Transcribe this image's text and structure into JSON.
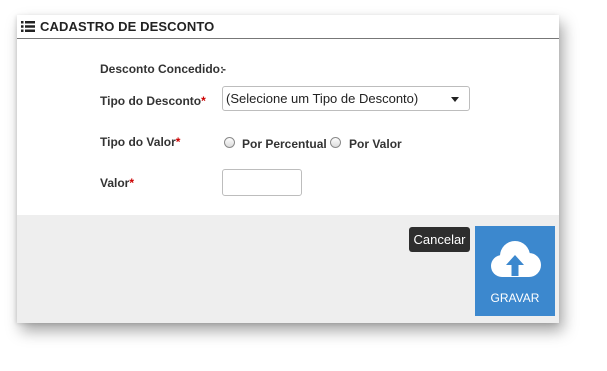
{
  "header": {
    "title": "CADASTRO DE DESCONTO",
    "icon": "list-icon"
  },
  "form": {
    "desconto_concedido_label": "Desconto Concedido:",
    "desconto_concedido_value": "-",
    "tipo_desconto_label": "Tipo do Desconto",
    "tipo_desconto_value": "(Selecione um Tipo de Desconto)",
    "tipo_valor_label": "Tipo do Valor",
    "radio_percentual": "Por Percentual",
    "radio_valor": "Por Valor",
    "valor_label": "Valor",
    "valor_value": "",
    "required_mark": "*"
  },
  "actions": {
    "cancel_label": "Cancelar",
    "save_label": "GRAVAR",
    "save_icon": "cloud-upload-icon"
  },
  "colors": {
    "save_button": "#3c88ce",
    "cancel_button": "#2e2e2e",
    "footer_bg": "#eeeeee",
    "required": "#cc0000"
  }
}
